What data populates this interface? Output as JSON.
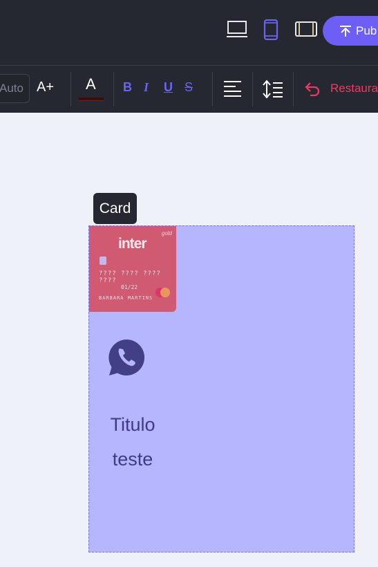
{
  "header": {
    "device_buttons": [
      {
        "name": "desktop",
        "active": false
      },
      {
        "name": "mobile",
        "active": true
      },
      {
        "name": "tablet",
        "active": false
      }
    ],
    "publish_label": "Pub"
  },
  "toolbar": {
    "font_size_placeholder": "Auto",
    "grow_label": "A+",
    "text_color_label": "A",
    "bold_label": "B",
    "italic_label": "I",
    "underline_label": "U",
    "strike_label": "S",
    "restore_label": "Restaura"
  },
  "canvas": {
    "tooltip_label": "Card",
    "card": {
      "image": {
        "tier": "gold",
        "brand": "inter",
        "number": "???? ???? ???? ????",
        "valid": "01/22",
        "holder": "BARBARA MARTINS",
        "network": "mastercard"
      },
      "icon": "whatsapp-icon",
      "title": "Titulo\nteste"
    }
  },
  "colors": {
    "accent": "#6d5ff5",
    "danger": "#ee3a62",
    "card_bg": "#b6b5ff",
    "dark_bar": "#252830"
  }
}
